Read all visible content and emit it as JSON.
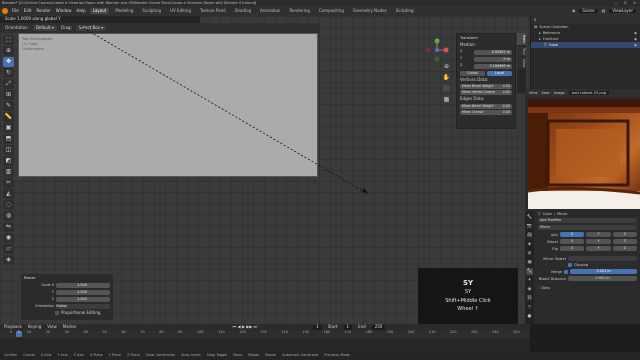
{
  "window": {
    "title": "Blender* [D:\\Online Course\\Create a Victorian Room with Blender and SP\\Blender Scene Files\\Create a Victorian Room with Blender 03.blend]"
  },
  "menu": {
    "items": [
      "File",
      "Edit",
      "Render",
      "Window",
      "Help"
    ],
    "workspaces": [
      "Layout",
      "Modeling",
      "Sculpting",
      "UV Editing",
      "Texture Paint",
      "Shading",
      "Animation",
      "Rendering",
      "Compositing",
      "Geometry Nodes",
      "Scripting"
    ],
    "active_workspace": "Layout",
    "scene_label": "Scene",
    "viewlayer_label": "ViewLayer"
  },
  "viewport": {
    "operator_status": "Scale 1.0000 along global Y",
    "orientation_label": "Orientation:",
    "orientation_value": "Default",
    "drag_label": "Drag:",
    "drag_value": "Select Box",
    "image_overlay": [
      "Top Orthographic",
      "(1) Cube",
      "Centimeters"
    ]
  },
  "npanel": {
    "tabs": [
      "Item",
      "Tool",
      "View"
    ],
    "active_tab": "Item",
    "section": "Transform",
    "median_label": "Median:",
    "median": [
      {
        "axis": "X",
        "value": "0.90462 m"
      },
      {
        "axis": "Y",
        "value": "0 m"
      },
      {
        "axis": "Z",
        "value": "0.164969 m"
      }
    ],
    "space_buttons": [
      "Global",
      "Local"
    ],
    "active_space": "Local",
    "vertex_data_label": "Vertices Data:",
    "vertex_fields": [
      {
        "label": "Mean Bevel Weight",
        "value": "0.00"
      },
      {
        "label": "Mean Vertex Crease",
        "value": "0.00"
      }
    ],
    "edge_data_label": "Edges Data:",
    "edge_fields": [
      {
        "label": "Mean Bevel Weight",
        "value": "0.00"
      },
      {
        "label": "Mean Crease",
        "value": "0.00"
      }
    ]
  },
  "redo_panel": {
    "title": "Resize",
    "fields": [
      {
        "label": "Scale X",
        "value": "1.000"
      },
      {
        "label": "Y",
        "value": "1.000"
      },
      {
        "label": "Z",
        "value": "1.000"
      }
    ],
    "orientation_label": "Orientation",
    "orientation_value": "Global",
    "proportional_label": "Proportional Editing"
  },
  "screencast": {
    "key": "SY",
    "line1": "SY",
    "line2": "Shift+Middle Click",
    "line3": "Wheel ↑"
  },
  "timeline": {
    "menus": [
      "Playback",
      "Keying",
      "View",
      "Marker"
    ],
    "current_frame": "1",
    "start_label": "Start",
    "start": "1",
    "end_label": "End",
    "end": "250",
    "ticks": [
      "0",
      "10",
      "20",
      "30",
      "40",
      "50",
      "60",
      "70",
      "80",
      "90",
      "100",
      "110",
      "120",
      "130",
      "140",
      "150",
      "160",
      "170",
      "180",
      "190",
      "200",
      "210",
      "220",
      "230",
      "240",
      "250"
    ]
  },
  "statusbar": {
    "items": [
      "Confirm",
      "Cancel",
      "X Axis",
      "Y Axis",
      "Z Axis",
      "X Plane",
      "Y Plane",
      "Z Plane",
      "Clear Constraints",
      "Snap Invert",
      "Snap Toggle",
      "Move",
      "Rotate",
      "Resize",
      "Automatic Constraint",
      "Precision Mode"
    ]
  },
  "outliner": {
    "rows": [
      {
        "label": "Scene Collection",
        "sel": false
      },
      {
        "label": "Reference",
        "sel": false
      },
      {
        "label": "Furniture",
        "sel": false
      },
      {
        "label": "Cube",
        "sel": true
      }
    ]
  },
  "image_editor": {
    "menus": [
      "View",
      "View",
      "Image"
    ],
    "image_name": "wall cabinet 03.png"
  },
  "properties": {
    "object_name": "Cube",
    "modifier_name": "Mirror",
    "add_modifier": "Add Modifier",
    "axis_label": "Axis",
    "bisect_label": "Bisect",
    "flip_label": "Flip",
    "axes": [
      "X",
      "Y",
      "Z"
    ],
    "mirror_object_label": "Mirror Object",
    "clipping_label": "Clipping",
    "merge_label": "Merge",
    "merge_value": "0.001 m",
    "bisect_distance_label": "Bisect Distance",
    "bisect_distance_value": "0.001 m",
    "data_label": "Data"
  },
  "colors": {
    "accent": "#4772b3",
    "selection": "#e87d0d",
    "viewport_bg": "#3a3a3a"
  }
}
